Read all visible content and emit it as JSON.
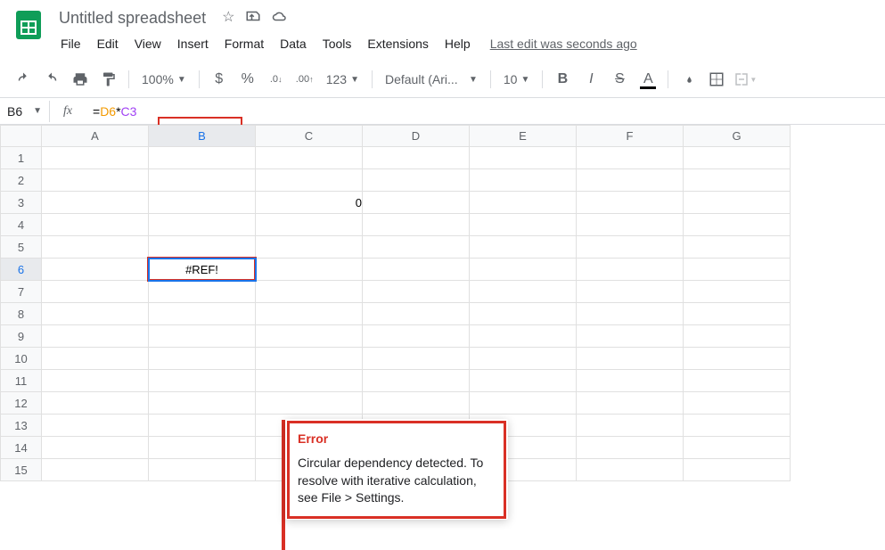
{
  "header": {
    "doc_title": "Untitled spreadsheet",
    "last_edit": "Last edit was seconds ago"
  },
  "menubar": {
    "items": [
      "File",
      "Edit",
      "View",
      "Insert",
      "Format",
      "Data",
      "Tools",
      "Extensions",
      "Help"
    ]
  },
  "toolbar": {
    "zoom": "100%",
    "currency": "$",
    "percent": "%",
    "dec_decrease": ".0",
    "dec_increase": ".00",
    "format_123": "123",
    "font": "Default (Ari...",
    "font_size": "10"
  },
  "formula_bar": {
    "name_box": "B6",
    "formula_eq": "=",
    "formula_ref1": "D6",
    "formula_op": "*",
    "formula_ref2": "C3"
  },
  "grid": {
    "columns": [
      "A",
      "B",
      "C",
      "D",
      "E",
      "F",
      "G"
    ],
    "rows": [
      "1",
      "2",
      "3",
      "4",
      "5",
      "6",
      "7",
      "8",
      "9",
      "10",
      "11",
      "12",
      "13",
      "14",
      "15"
    ],
    "cells": {
      "C3": "0",
      "B6": "#REF!"
    },
    "selected": "B6",
    "active_col": "B",
    "active_row": "6"
  },
  "error": {
    "title": "Error",
    "body": "Circular dependency detected. To resolve with iterative calculation, see File > Settings."
  }
}
